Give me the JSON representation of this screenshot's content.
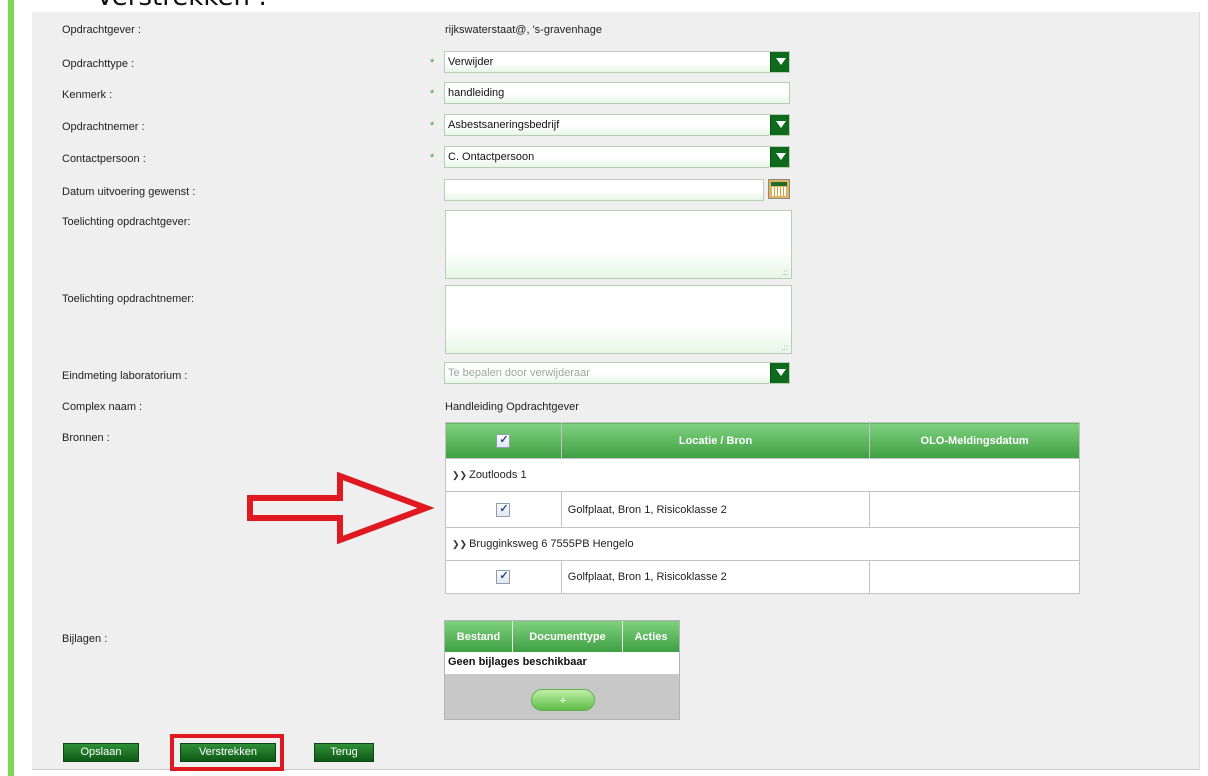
{
  "page": {
    "top_title": "Verstrekken :"
  },
  "form": {
    "opdrachtgever_label": "Opdrachtgever :",
    "opdrachtgever_value": "rijkswaterstaat@, 's-gravenhage",
    "opdrachttype_label": "Opdrachttype :",
    "opdrachttype_value": "Verwijder",
    "kenmerk_label": "Kenmerk :",
    "kenmerk_value": "handleiding",
    "opdrachtnemer_label": "Opdrachtnemer :",
    "opdrachtnemer_value": "Asbestsaneringsbedrijf",
    "contactpersoon_label": "Contactpersoon :",
    "contactpersoon_value": "C. Ontactpersoon",
    "datum_label": "Datum uitvoering gewenst :",
    "datum_value": "",
    "toelichting_gever_label": "Toelichting opdrachtgever:",
    "toelichting_gever_value": "",
    "toelichting_nemer_label": "Toelichting opdrachtnemer:",
    "toelichting_nemer_value": "",
    "eindmeting_label": "Eindmeting laboratorium :",
    "eindmeting_placeholder": "Te bepalen door verwijderaar",
    "complex_label": "Complex naam :",
    "complex_value": "Handleiding Opdrachtgever",
    "bronnen_label": "Bronnen :",
    "bijlagen_label": "Bijlagen :",
    "required_marker": "*",
    "textarea_grip": ".::"
  },
  "bronnen": {
    "headers": {
      "locatie": "Locatie / Bron",
      "olo": "OLO-Meldingsdatum"
    },
    "groups": [
      {
        "name": "Zoutloods 1",
        "rows": [
          {
            "checked": true,
            "locatie": "Golfplaat, Bron 1, Risicoklasse 2",
            "olo": ""
          }
        ]
      },
      {
        "name": "Brugginksweg 6 7555PB Hengelo",
        "rows": [
          {
            "checked": true,
            "locatie": "Golfplaat, Bron 1, Risicoklasse 2",
            "olo": ""
          }
        ]
      }
    ]
  },
  "bijlagen": {
    "headers": {
      "bestand": "Bestand",
      "documenttype": "Documenttype",
      "acties": "Acties"
    },
    "empty_text": "Geen bijlages beschikbaar",
    "add_label": "+"
  },
  "buttons": {
    "opslaan": "Opslaan",
    "verstrekken": "Verstrekken",
    "terug": "Terug"
  },
  "colors": {
    "accent_green": "#0f6b1c",
    "stripe_green": "#7ed957",
    "highlight_red": "#e0181f"
  }
}
